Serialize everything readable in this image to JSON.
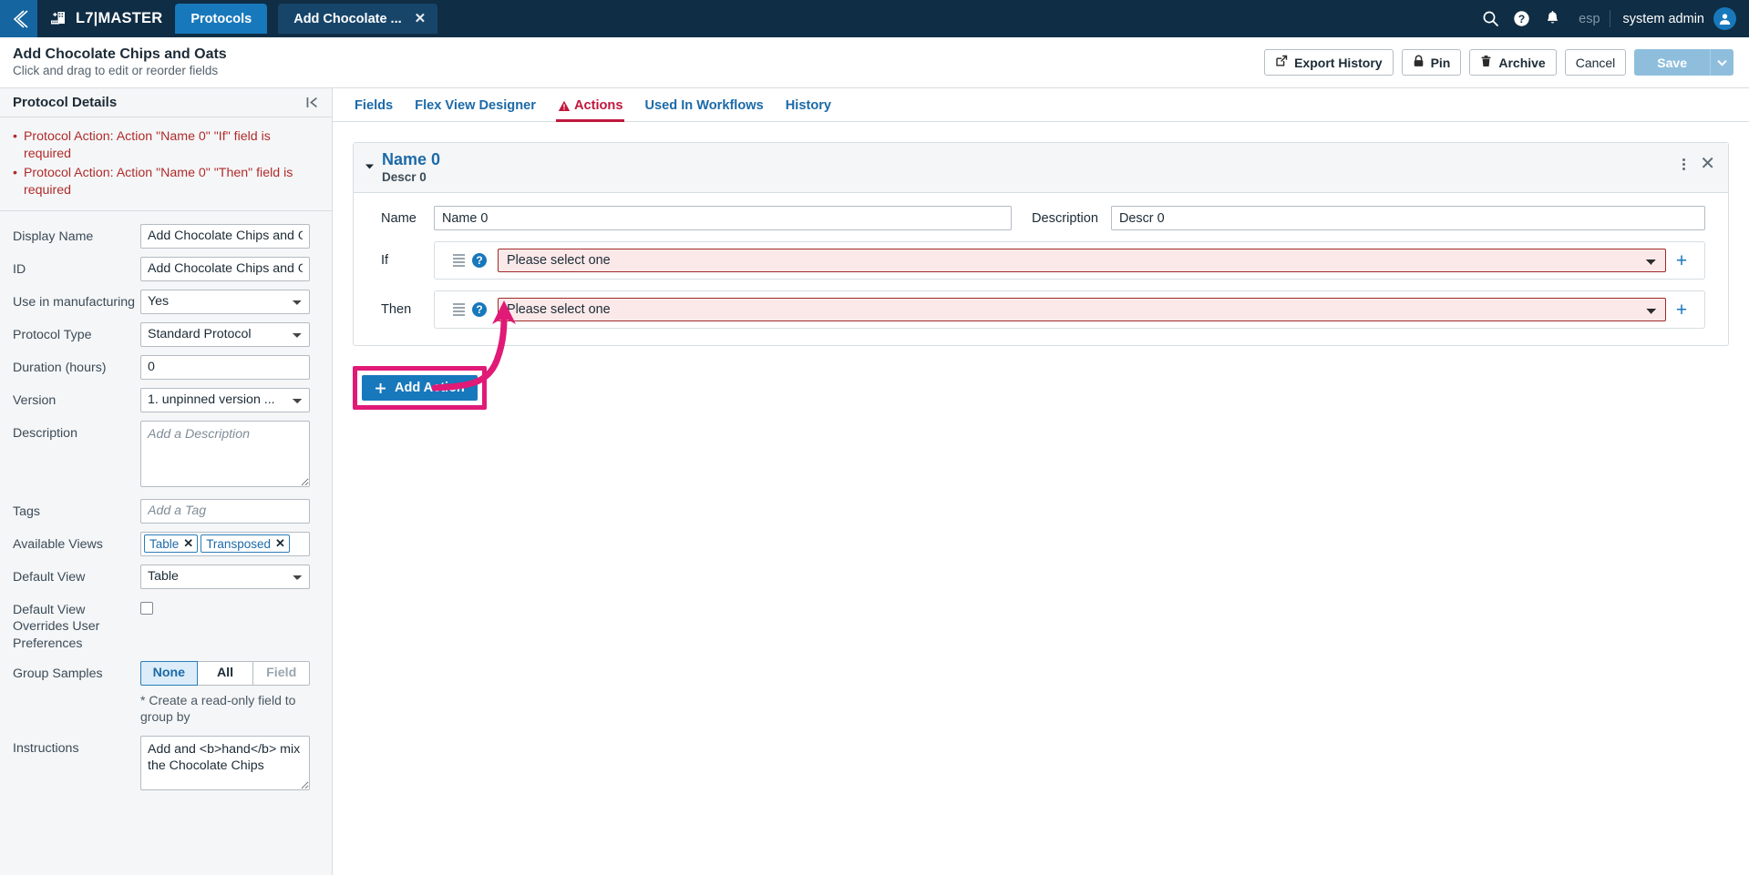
{
  "topbar": {
    "back_icon": "chevron-left-icon",
    "logo_icon": "building-plus-icon",
    "brand": "L7|MASTER",
    "tabs": [
      {
        "label": "Protocols",
        "closable": false
      },
      {
        "label": "Add Chocolate ...",
        "closable": true,
        "close_label": "✕"
      }
    ],
    "search_icon": "search-icon",
    "help_icon": "help-circle-icon",
    "notifications_icon": "bell-icon",
    "language": "esp",
    "user": "system admin",
    "avatar_icon": "user-avatar-icon",
    "bg_color": "#0f2d44",
    "accent_color": "#1878bc"
  },
  "pagehead": {
    "title": "Add Chocolate Chips and Oats",
    "subtitle": "Click and drag to edit or reorder fields",
    "buttons": [
      {
        "label": "Export History",
        "icon": "external-link-icon"
      },
      {
        "label": "Pin",
        "icon": "lock-icon"
      },
      {
        "label": "Archive",
        "icon": "trash-icon"
      },
      {
        "label": "Cancel",
        "icon": ""
      }
    ],
    "save": {
      "label": "Save",
      "disabled": true,
      "caret_icon": "chevron-down-icon",
      "color": "#8fbedd"
    }
  },
  "sidebar": {
    "title": "Protocol Details",
    "collapse_icon": "collapse-left-icon",
    "errors": [
      "Protocol Action: Action \"Name 0\" \"If\" field is required",
      "Protocol Action: Action \"Name 0\" \"Then\" field is required"
    ],
    "error_color": "#b02b2b",
    "fields": [
      {
        "label": "Display Name",
        "type": "text",
        "value": "Add Chocolate Chips and Oats"
      },
      {
        "label": "ID",
        "type": "text",
        "value": "Add Chocolate Chips and Oats"
      },
      {
        "label": "Use in manufacturing",
        "type": "select",
        "value": "Yes"
      },
      {
        "label": "Protocol Type",
        "type": "select",
        "value": "Standard Protocol"
      },
      {
        "label": "Duration (hours)",
        "type": "text",
        "value": "0"
      },
      {
        "label": "Version",
        "type": "select",
        "value": "1. unpinned version ..."
      },
      {
        "label": "Description",
        "type": "textarea",
        "value": "",
        "placeholder": "Add a Description"
      },
      {
        "label": "Tags",
        "type": "text",
        "value": "",
        "placeholder": "Add a Tag"
      },
      {
        "label": "Available Views",
        "type": "chips",
        "chips": [
          "Table",
          "Transposed"
        ]
      },
      {
        "label": "Default View",
        "type": "select",
        "value": "Table"
      },
      {
        "label": "Default View Overrides User Preferences",
        "type": "checkbox",
        "checked": false
      },
      {
        "label": "Group Samples",
        "type": "segmented",
        "options": [
          "None",
          "All",
          "Field"
        ],
        "selected": "None",
        "disabled_options": [
          "Field"
        ]
      }
    ],
    "group_hint": "* Create a read-only field to group by",
    "instructions": {
      "label": "Instructions",
      "value": "Add and <b>hand</b> mix the Chocolate Chips"
    }
  },
  "main": {
    "tabs": [
      {
        "label": "Fields",
        "active": false,
        "warning": false
      },
      {
        "label": "Flex View Designer",
        "active": false,
        "warning": false
      },
      {
        "label": "Actions",
        "active": true,
        "warning": true,
        "warning_icon": "warning-triangle-icon"
      },
      {
        "label": "Used In Workflows",
        "active": false,
        "warning": false
      },
      {
        "label": "History",
        "active": false,
        "warning": false
      }
    ],
    "action_card": {
      "title": "Name 0",
      "subtitle": "Descr 0",
      "caret_icon": "caret-down-icon",
      "kebab_icon": "kebab-menu-icon",
      "close_icon": "close-icon",
      "name_label": "Name",
      "name_value": "Name 0",
      "description_label": "Description",
      "description_value": "Descr 0",
      "rows": [
        {
          "label": "If",
          "drag_icon": "drag-handle-icon",
          "help_icon": "help-circle-icon",
          "select_value": "Please select one",
          "select_error": true,
          "add_icon": "plus-icon"
        },
        {
          "label": "Then",
          "drag_icon": "drag-handle-icon",
          "help_icon": "help-circle-icon",
          "select_value": "Please select one",
          "select_error": true,
          "add_icon": "plus-icon"
        }
      ]
    },
    "add_action": {
      "label": "Add Action",
      "icon": "plus-icon"
    },
    "annotation": {
      "highlight_color": "#e01a76",
      "arrow_icon": "curved-arrow-icon"
    }
  }
}
